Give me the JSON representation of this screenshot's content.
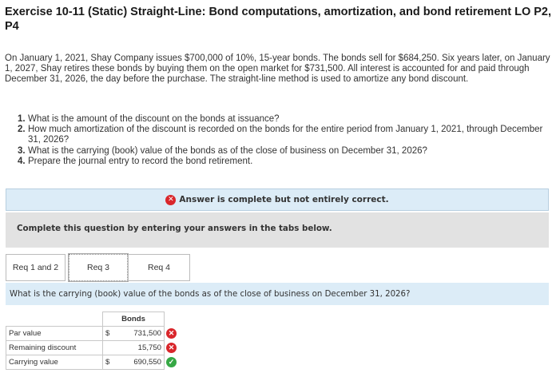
{
  "exercise": {
    "title": "Exercise 10-11 (Static) Straight-Line: Bond computations, amortization, and bond retirement LO P2, P4"
  },
  "problem": {
    "text": "On January 1, 2021, Shay Company issues $700,000 of 10%, 15-year bonds. The bonds sell for $684,250. Six years later, on January 1, 2027, Shay retires these bonds by buying them on the open market for $731,500. All interest is accounted for and paid through December 31, 2026, the day before the purchase. The straight-line method is used to amortize any bond discount.",
    "questions": [
      {
        "num": "1.",
        "text": "What is the amount of the discount on the bonds at issuance?"
      },
      {
        "num": "2.",
        "text": "How much amortization of the discount is recorded on the bonds for the entire period from January 1, 2021, through December 31, 2026?"
      },
      {
        "num": "3.",
        "text": "What is the carrying (book) value of the bonds as of the close of business on December 31, 2026?"
      },
      {
        "num": "4.",
        "text": "Prepare the journal entry to record the bond retirement."
      }
    ]
  },
  "status": {
    "icon": "x-circle-icon",
    "text": "Answer is complete but not entirely correct.",
    "color": "#d9262b"
  },
  "instruction": "Complete this question by entering your answers in the tabs below.",
  "tabs": [
    {
      "label": "Req 1 and 2",
      "active": false
    },
    {
      "label": "Req 3",
      "active": true
    },
    {
      "label": "Req 4",
      "active": false
    }
  ],
  "question": "What is the carrying (book) value of the bonds as of the close of business on December 31, 2026?",
  "answer_table": {
    "column_header": "Bonds",
    "rows": [
      {
        "label": "Par value",
        "currency": "$",
        "value": "731,500",
        "mark": "x-circle-icon"
      },
      {
        "label": "Remaining discount",
        "currency": "",
        "value": "15,750",
        "mark": "x-circle-icon"
      },
      {
        "label": "Carrying value",
        "currency": "$",
        "value": "690,550",
        "mark": "check-circle-icon"
      }
    ]
  }
}
